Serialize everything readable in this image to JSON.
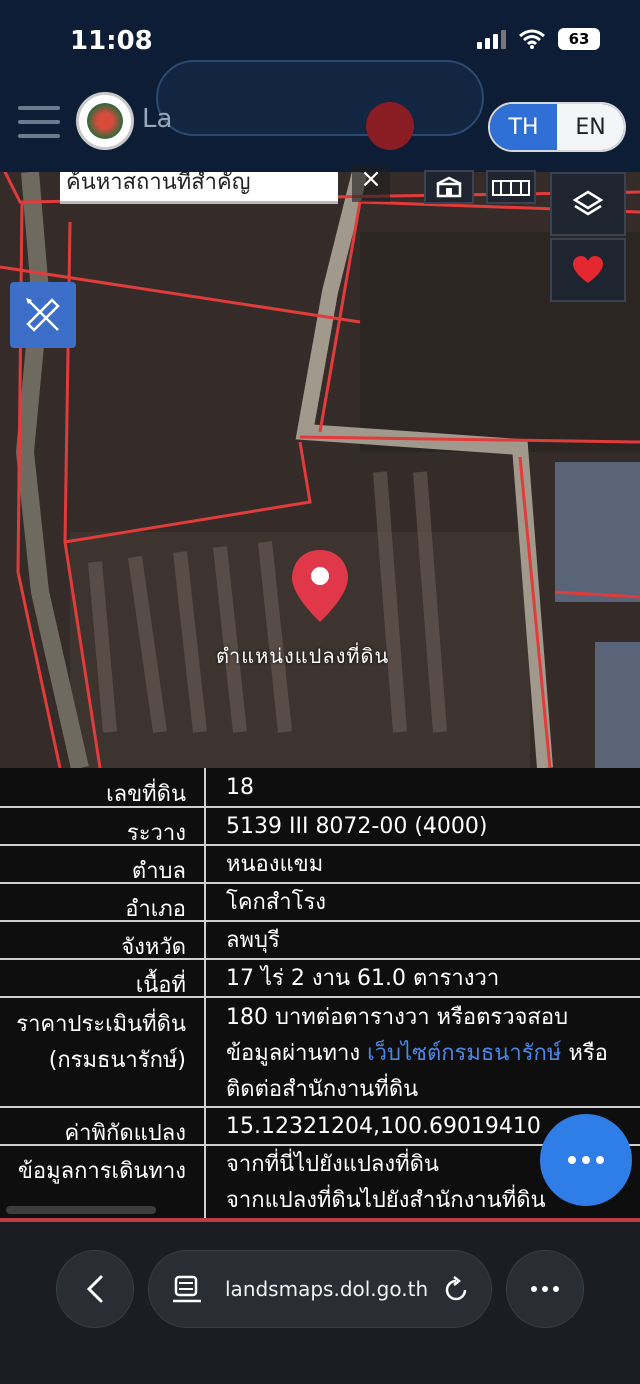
{
  "status_bar": {
    "time": "11:08",
    "battery": "63"
  },
  "header": {
    "brand": "La",
    "lang_th": "TH",
    "lang_en": "EN"
  },
  "map": {
    "search_placeholder": "ค้นหาสถานที่สำคัญ",
    "clear_symbol": "×",
    "pin_label": "ตำแหน่งแปลงที่ดิน"
  },
  "info": {
    "rows": [
      {
        "label": "เลขที่ดิน",
        "value": "18"
      },
      {
        "label": "ระวาง",
        "value": "5139 III 8072-00 (4000)"
      },
      {
        "label": "ตำบล",
        "value": "หนองแขม"
      },
      {
        "label": "อำเภอ",
        "value": "โคกสำโรง"
      },
      {
        "label": "จังหวัด",
        "value": "ลพบุรี"
      },
      {
        "label": "เนื้อที่",
        "value": "17 ไร่ 2 งาน 61.0 ตารางวา"
      }
    ],
    "price": {
      "label_line1": "ราคาประเมินที่ดิน",
      "label_line2": "(กรมธนารักษ์)",
      "line1": "180 บาทต่อตารางวา หรือตรวจสอบ",
      "line2_prefix": "ข้อมูลผ่านทาง ",
      "line2_link": "เว็บไซต์กรมธนารักษ์",
      "line2_suffix": " หรือ",
      "line3": "ติดต่อสำนักงานที่ดิน"
    },
    "coords": {
      "label": "ค่าพิกัดแปลง",
      "value": "15.12321204,100.69019410"
    },
    "directions": {
      "label": "ข้อมูลการเดินทาง",
      "link1": "จากที่นี่ไปยังแปลงที่ดิน",
      "link2": "จากแปลงที่ดินไปยังสำนักงานที่ดิน"
    }
  },
  "browser": {
    "url": "landsmaps.dol.go.th"
  },
  "colors": {
    "accent": "#2f7de6",
    "parcel_line": "#e23b3b",
    "link": "#4b86e8"
  }
}
